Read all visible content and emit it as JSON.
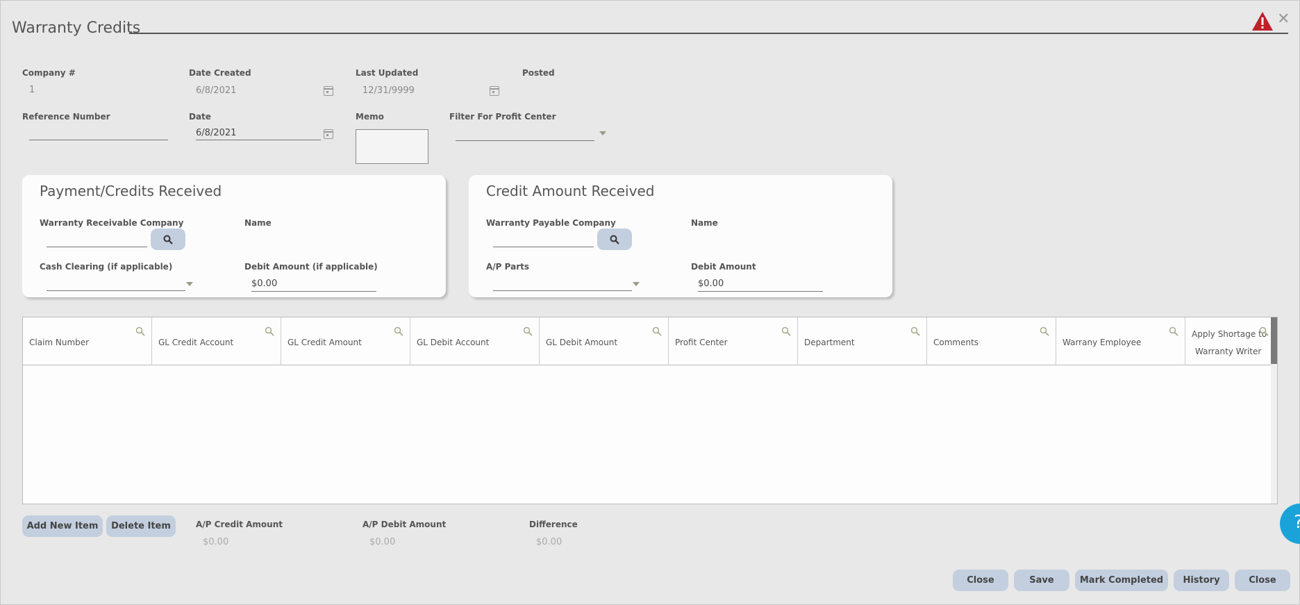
{
  "window": {
    "title": "Warranty Credits"
  },
  "header_fields": {
    "company_label": "Company #",
    "company_value": "1",
    "date_created_label": "Date Created",
    "date_created_value": "6/8/2021",
    "last_updated_label": "Last Updated",
    "last_updated_value": "12/31/9999",
    "posted_label": "Posted",
    "reference_label": "Reference Number",
    "reference_value": "",
    "date_label": "Date",
    "date_value": "6/8/2021",
    "memo_label": "Memo",
    "memo_value": "",
    "filter_label": "Filter For Profit Center",
    "filter_value": ""
  },
  "payment_card": {
    "title": "Payment/Credits Received",
    "receivable_company_label": "Warranty Receivable Company",
    "receivable_company_value": "",
    "name_label": "Name",
    "cash_clearing_label": "Cash Clearing (if applicable)",
    "cash_clearing_value": "",
    "debit_amount_label": "Debit Amount (if applicable)",
    "debit_amount_value": "$0.00"
  },
  "credit_card": {
    "title": "Credit Amount Received",
    "payable_company_label": "Warranty Payable Company",
    "payable_company_value": "",
    "name_label": "Name",
    "ap_parts_label": "A/P Parts",
    "ap_parts_value": "",
    "debit_amount_label": "Debit Amount",
    "debit_amount_value": "$0.00"
  },
  "grid": {
    "columns": [
      "Claim Number",
      "GL Credit Account",
      "GL Credit Amount",
      "GL Debit Account",
      "GL Debit Amount",
      "Profit Center",
      "Department",
      "Comments",
      "Warrany Employee"
    ],
    "last_column_line1": "Apply Shortage to",
    "last_column_line2": "Warranty Writer"
  },
  "footer": {
    "add_new_item": "Add New Item",
    "delete_item": "Delete Item",
    "ap_credit_label": "A/P Credit Amount",
    "ap_credit_value": "$0.00",
    "ap_debit_label": "A/P Debit Amount",
    "ap_debit_value": "$0.00",
    "difference_label": "Difference",
    "difference_value": "$0.00"
  },
  "actions": {
    "close_left": "Close",
    "save": "Save",
    "mark_completed": "Mark Completed",
    "history": "History",
    "close_right": "Close"
  },
  "help": {
    "glyph": "?"
  },
  "icons": {
    "warning": "warning-triangle-icon",
    "close": "close-icon",
    "search": "magnifier-icon",
    "calendar": "calendar-icon",
    "dropdown": "chevron-down-icon"
  },
  "colors": {
    "accent_button": "#c3cfdf",
    "warning": "#c0202a",
    "help": "#1aa3d9"
  }
}
